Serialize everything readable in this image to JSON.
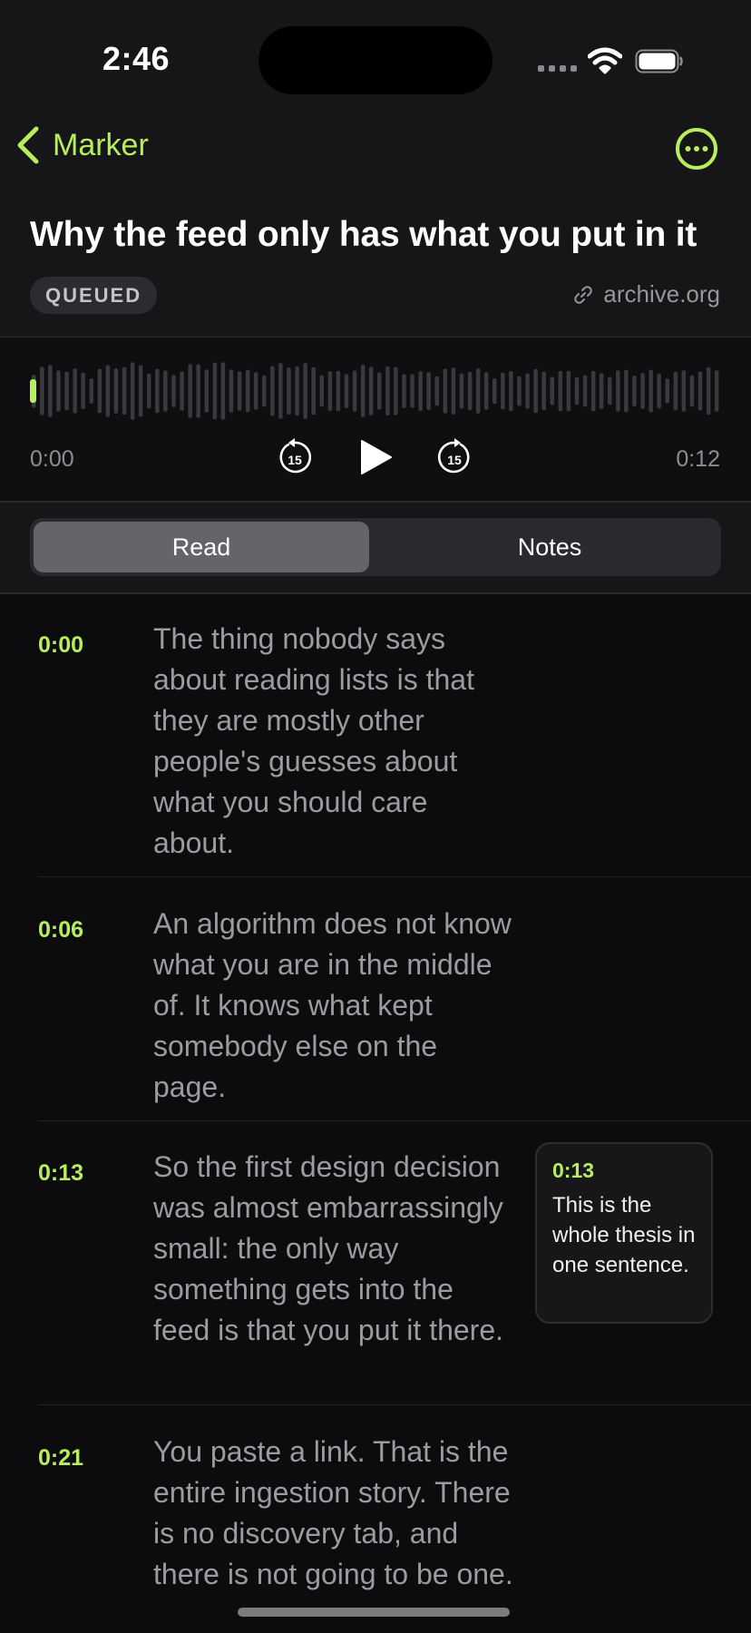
{
  "status_bar": {
    "time": "2:46"
  },
  "nav": {
    "back_label": "Marker"
  },
  "article": {
    "title": "Why the feed only has what you put in it",
    "badge": "QUEUED",
    "source": "archive.org"
  },
  "player": {
    "time_current": "0:00",
    "time_total": "0:12",
    "skip_back_seconds": "15",
    "skip_forward_seconds": "15",
    "progress": 0.0
  },
  "tabs": [
    {
      "label": "Read",
      "active": true
    },
    {
      "label": "Notes",
      "active": false
    }
  ],
  "transcript": [
    {
      "time": "0:00",
      "text": "The thing nobody says about reading lists is that they are mostly other people's guesses about what you should care about."
    },
    {
      "time": "0:06",
      "text": "An algorithm does not know what you are in the middle of. It knows what kept somebody else on the page."
    },
    {
      "time": "0:13",
      "text": "So the first design decision was almost embarrassingly small: the only way something gets into the feed is that you put it there."
    },
    {
      "time": "0:21",
      "text": "You paste a link. That is the entire ingestion story. There is no discovery tab, and there is not going to be one."
    }
  ],
  "note": {
    "time": "0:13",
    "text": "This is the whole thesis in one sentence."
  },
  "colors": {
    "accent": "#b8ee5c",
    "background": "#0c0c0e",
    "header": "#161619",
    "muted_text": "#9c9ca0"
  }
}
